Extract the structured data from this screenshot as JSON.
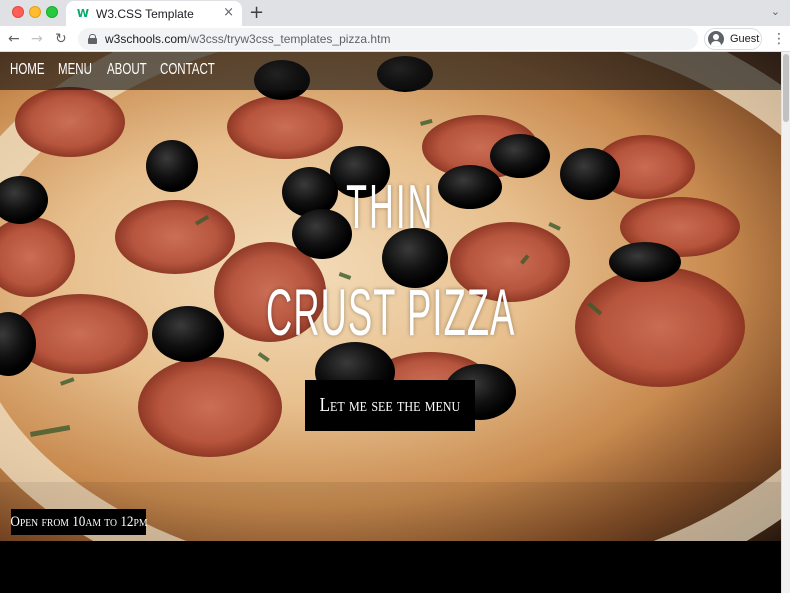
{
  "browser": {
    "tab_title": "W3.CSS Template",
    "favicon_text": "W",
    "tab_close": "×",
    "new_tab": "+",
    "tab_menu": "⌄",
    "back": "←",
    "forward": "→",
    "reload": "↻",
    "url_host": "w3schools.com",
    "url_path": "/w3css/tryw3css_templates_pizza.htm",
    "profile_label": "Guest",
    "menu": "⋮"
  },
  "nav": {
    "home": "Home",
    "menu": "Menu",
    "about": "About",
    "contact": "Contact"
  },
  "hero": {
    "title_line1": "Thin",
    "title_line2": "Crust Pizza",
    "cta": "Let me see the menu",
    "hours": "Open from 10am to 12pm"
  },
  "colors": {
    "nav_bg": "#141414",
    "button_bg": "#000000",
    "favicon": "#04aa6d"
  }
}
